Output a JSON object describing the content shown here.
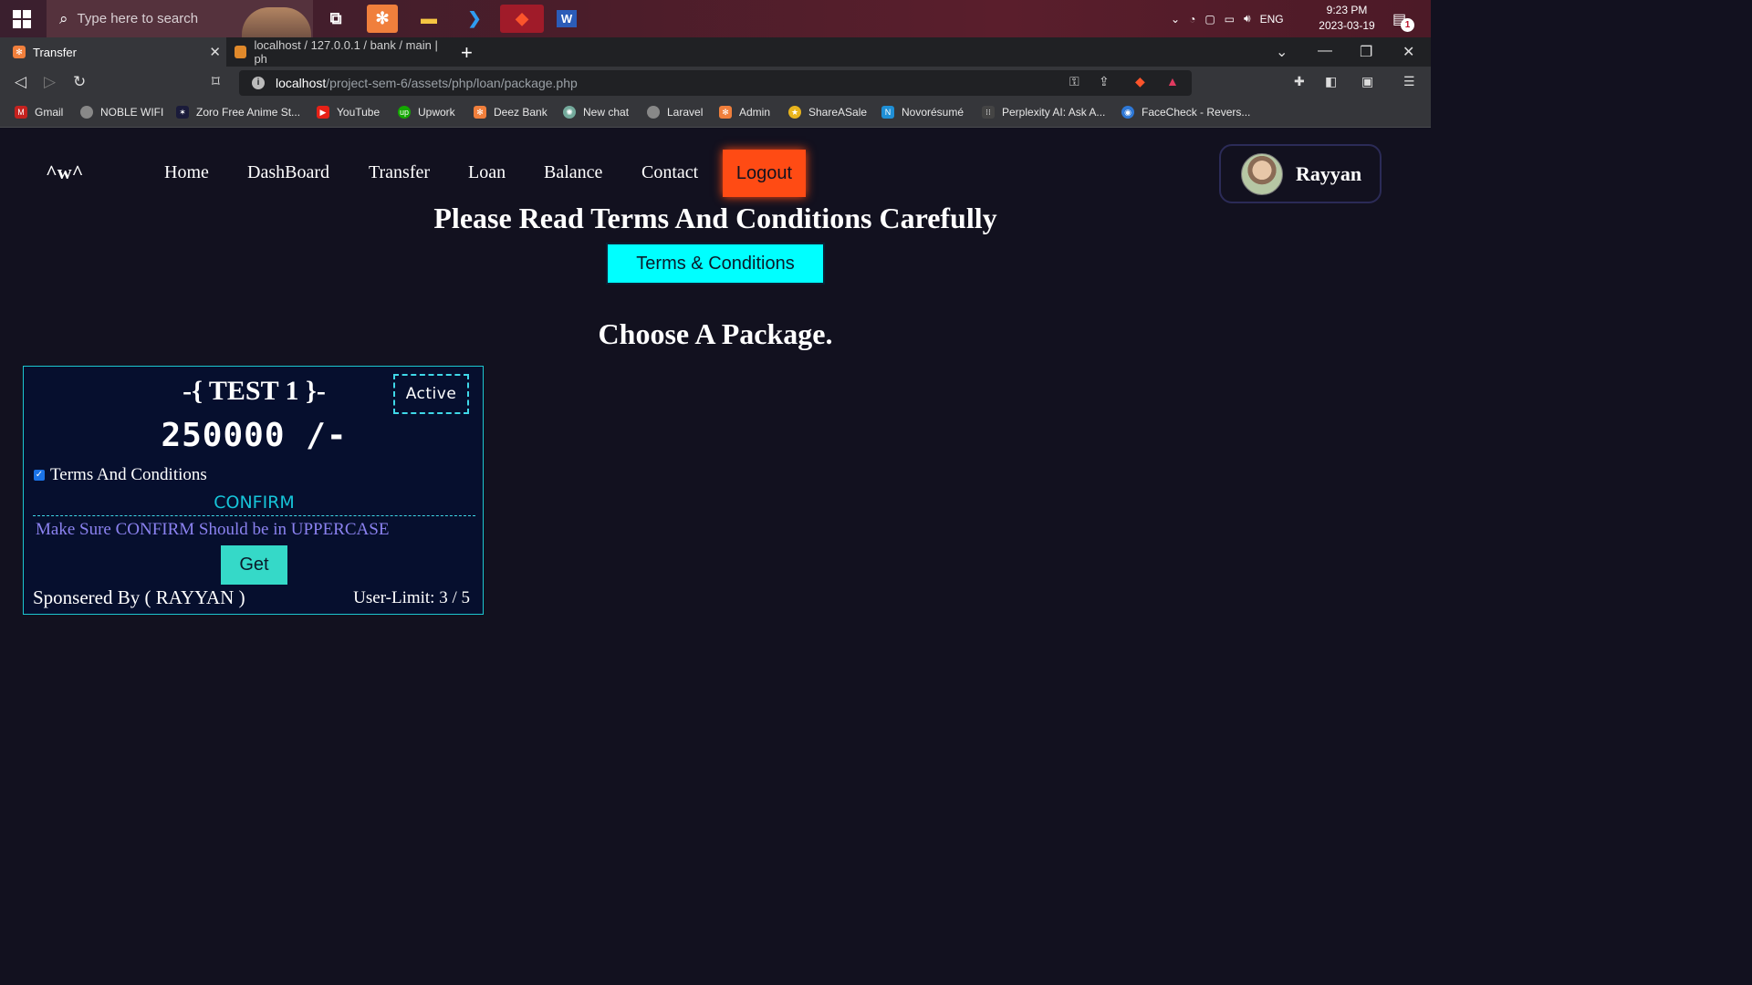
{
  "taskbar": {
    "search_placeholder": "Type here to search",
    "language": "ENG",
    "time": "9:23 PM",
    "date": "2023-03-19",
    "notification_count": "1"
  },
  "browser": {
    "active_tab": "Transfer",
    "inactive_tab": "localhost / 127.0.0.1 / bank / main | ph",
    "url_host": "localhost",
    "url_path": "/project-sem-6/assets/php/loan/package.php",
    "bookmarks": [
      "Gmail",
      "NOBLE WIFI",
      "Zoro Free Anime St...",
      "YouTube",
      "Upwork",
      "Deez Bank",
      "New chat",
      "Laravel",
      "Admin",
      "ShareASale",
      "Novorésumé",
      "Perplexity AI: Ask A...",
      "FaceCheck - Revers..."
    ]
  },
  "nav": {
    "brand": "^w^",
    "items": [
      "Home",
      "DashBoard",
      "Transfer",
      "Loan",
      "Balance",
      "Contact"
    ],
    "logout": "Logout",
    "user_name": "Rayyan"
  },
  "main": {
    "heading": "Please Read Terms And Conditions Carefully",
    "terms_button": "Terms & Conditions",
    "packages_heading": "Choose A Package."
  },
  "package": {
    "title": "-{ TEST 1 }-",
    "status": "Active",
    "amount": "250000 /-",
    "terms_label": "Terms And Conditions",
    "terms_checked": true,
    "confirm_value": "CONFIRM",
    "note": "Make Sure CONFIRM Should be in UPPERCASE",
    "get_button": "Get",
    "sponsor": "Sponsered By ( RAYYAN )",
    "user_limit": "User-Limit: 3 / 5"
  },
  "colors": {
    "background": "#12111f",
    "logout": "#ff4b14",
    "terms_button": "#00ffff",
    "card_border": "#1cc6cf",
    "get_button": "#35d9c8",
    "note": "#8b82f0"
  }
}
